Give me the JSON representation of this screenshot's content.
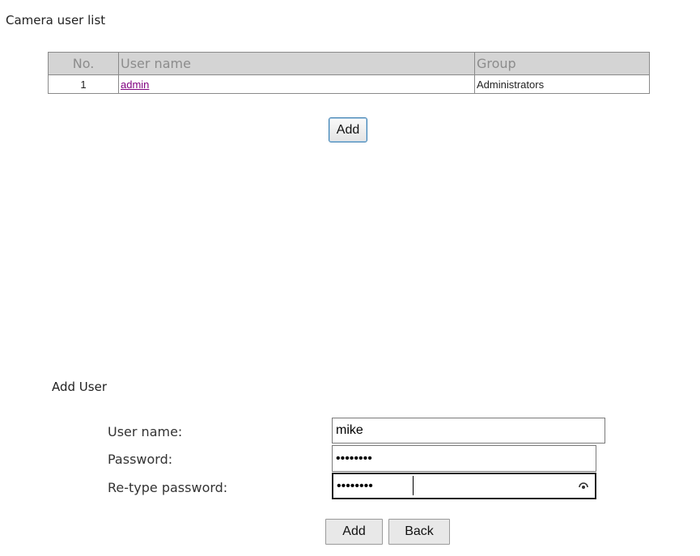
{
  "user_list": {
    "title": "Camera user list",
    "columns": [
      "No.",
      "User name",
      "Group"
    ],
    "rows": [
      {
        "no": "1",
        "username": "admin",
        "group": "Administrators"
      }
    ],
    "add_button_label": "Add"
  },
  "add_user": {
    "title": "Add User",
    "username_label": "User name:",
    "username_value": "mike",
    "password_label": "Password:",
    "password_value": "••••••••",
    "retype_label": "Re-type password:",
    "retype_value": "••••••••",
    "add_button_label": "Add",
    "back_button_label": "Back"
  },
  "colors": {
    "header_bg": "#d4d4d4",
    "header_text": "#8c8c8c",
    "link": "#800080",
    "focus_border": "#3c7fb1"
  },
  "icons": {
    "reveal_password": "eye-icon"
  }
}
